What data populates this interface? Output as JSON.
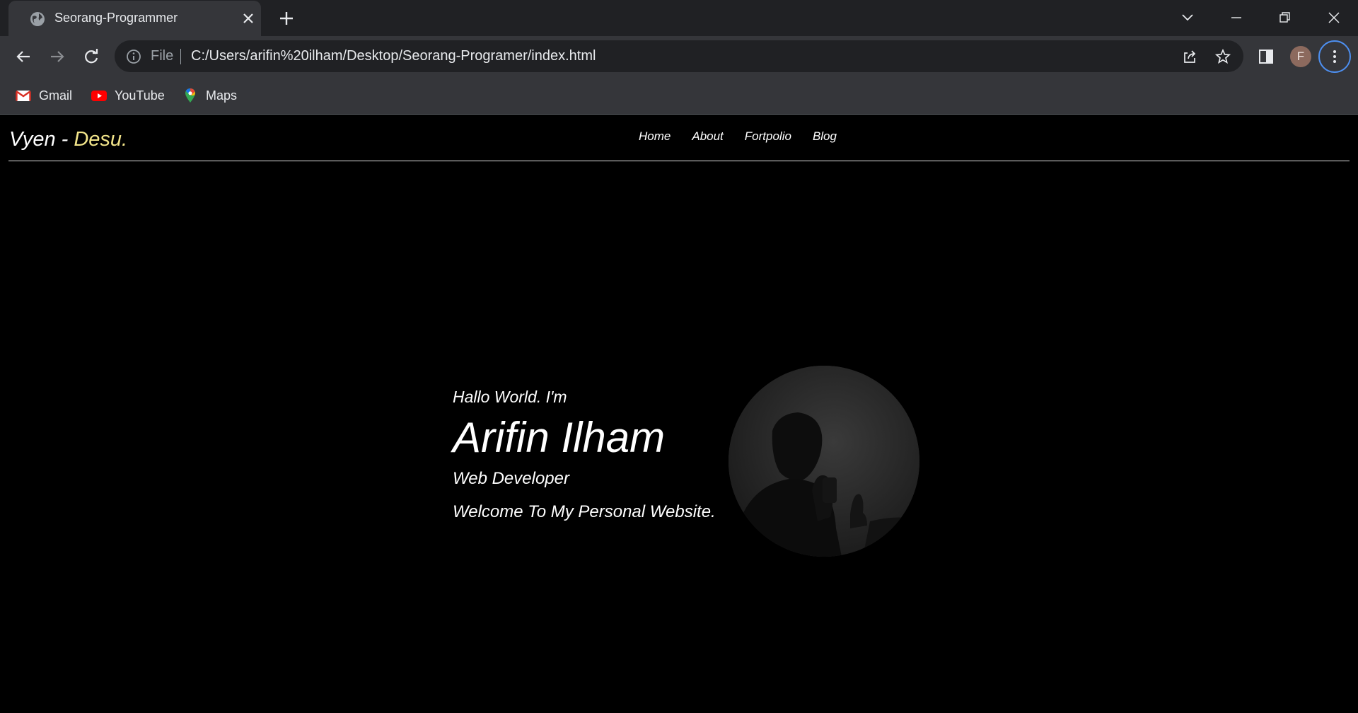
{
  "browser": {
    "tab_title": "Seorang-Programmer",
    "url_scheme": "File",
    "url": "C:/Users/arifin%20ilham/Desktop/Seorang-Programer/index.html",
    "profile_initial": "F",
    "bookmarks": [
      {
        "label": "Gmail",
        "icon": "gmail-icon"
      },
      {
        "label": "YouTube",
        "icon": "youtube-icon"
      },
      {
        "label": "Maps",
        "icon": "maps-icon"
      }
    ]
  },
  "site": {
    "brand_main": "Vyen - ",
    "brand_accent": "Desu.",
    "nav": [
      "Home",
      "About",
      "Fortpolio",
      "Blog"
    ]
  },
  "hero": {
    "greeting": "Hallo World. I'm",
    "name": "Arifin Ilham",
    "role": "Web Developer",
    "welcome": "Welcome To My Personal Website."
  },
  "colors": {
    "chrome_dark": "#202124",
    "chrome_toolbar": "#35363a",
    "page_bg": "#000000",
    "brand_accent": "#f3e58a",
    "focus_ring": "#4d8ff0"
  }
}
